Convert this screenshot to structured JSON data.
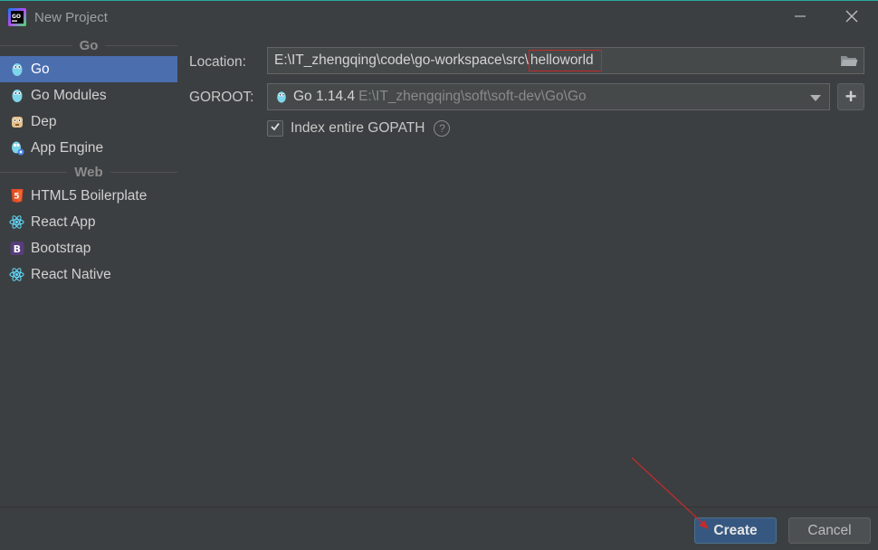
{
  "window": {
    "title": "New Project"
  },
  "sidebar": {
    "groups": [
      {
        "header": "Go",
        "items": [
          {
            "label": "Go",
            "icon": "gopher-icon",
            "selected": true
          },
          {
            "label": "Go Modules",
            "icon": "gopher-icon"
          },
          {
            "label": "Dep",
            "icon": "dep-icon"
          },
          {
            "label": "App Engine",
            "icon": "app-engine-icon"
          }
        ]
      },
      {
        "header": "Web",
        "items": [
          {
            "label": "HTML5 Boilerplate",
            "icon": "html5-icon"
          },
          {
            "label": "React App",
            "icon": "react-icon"
          },
          {
            "label": "Bootstrap",
            "icon": "bootstrap-icon"
          },
          {
            "label": "React Native",
            "icon": "react-icon"
          }
        ]
      }
    ]
  },
  "form": {
    "location_label": "Location:",
    "location_prefix": "E:\\IT_zhengqing\\code\\go-workspace\\src\\",
    "location_highlight": "helloworld",
    "goroot_label": "GOROOT:",
    "goroot_version": "Go 1.14.4",
    "goroot_path": "E:\\IT_zhengqing\\soft\\soft-dev\\Go\\Go",
    "add_sdk": "+",
    "index_gopath_label": "Index entire GOPATH",
    "index_gopath_checked": true,
    "help": "?"
  },
  "footer": {
    "create_label": "Create",
    "cancel_label": "Cancel"
  },
  "colors": {
    "background": "#3c3f41",
    "selection": "#4b6eaf",
    "primary_button": "#365880",
    "annotation": "#c42b2b"
  }
}
